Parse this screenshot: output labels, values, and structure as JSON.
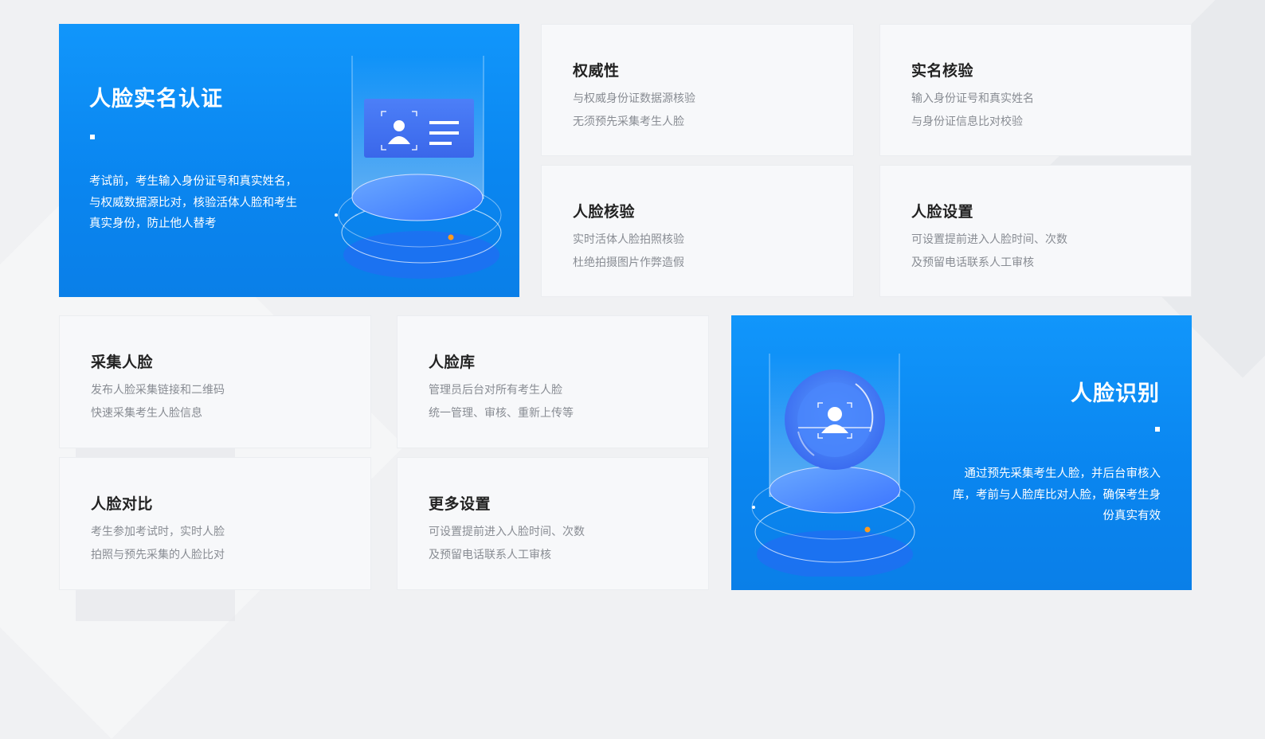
{
  "hero_left": {
    "title": "人脸实名认证",
    "description": "考试前，考生输入身份证号和真实姓名，与权威数据源比对，核验活体人脸和考生真实身份，防止他人替考"
  },
  "hero_right": {
    "title": "人脸识别",
    "description": "通过预先采集考生人脸，并后台审核入库，考前与人脸库比对人脸，确保考生身份真实有效"
  },
  "features": [
    {
      "title": "权威性",
      "line1": "与权威身份证数据源核验",
      "line2": "无须预先采集考生人脸"
    },
    {
      "title": "实名核验",
      "line1": "输入身份证号和真实姓名",
      "line2": "与身份证信息比对校验"
    },
    {
      "title": "人脸核验",
      "line1": "实时活体人脸拍照核验",
      "line2": "杜绝拍摄图片作弊造假"
    },
    {
      "title": "人脸设置",
      "line1": "可设置提前进入人脸时间、次数",
      "line2": "及预留电话联系人工审核"
    },
    {
      "title": "采集人脸",
      "line1": "发布人脸采集链接和二维码",
      "line2": "快速采集考生人脸信息"
    },
    {
      "title": "人脸库",
      "line1": "管理员后台对所有考生人脸",
      "line2": "统一管理、审核、重新上传等"
    },
    {
      "title": "人脸对比",
      "line1": "考生参加考试时，实时人脸",
      "line2": "拍照与预先采集的人脸比对"
    },
    {
      "title": "更多设置",
      "line1": "可设置提前进入人脸时间、次数",
      "line2": "及预留电话联系人工审核"
    }
  ],
  "colors": {
    "accent": "#0a86f0",
    "card_bg": "#f7f8fa",
    "title": "#222222",
    "desc": "#888c93"
  },
  "icons": [
    "id-card-icon",
    "face-scan-icon",
    "pedestal-icon"
  ]
}
